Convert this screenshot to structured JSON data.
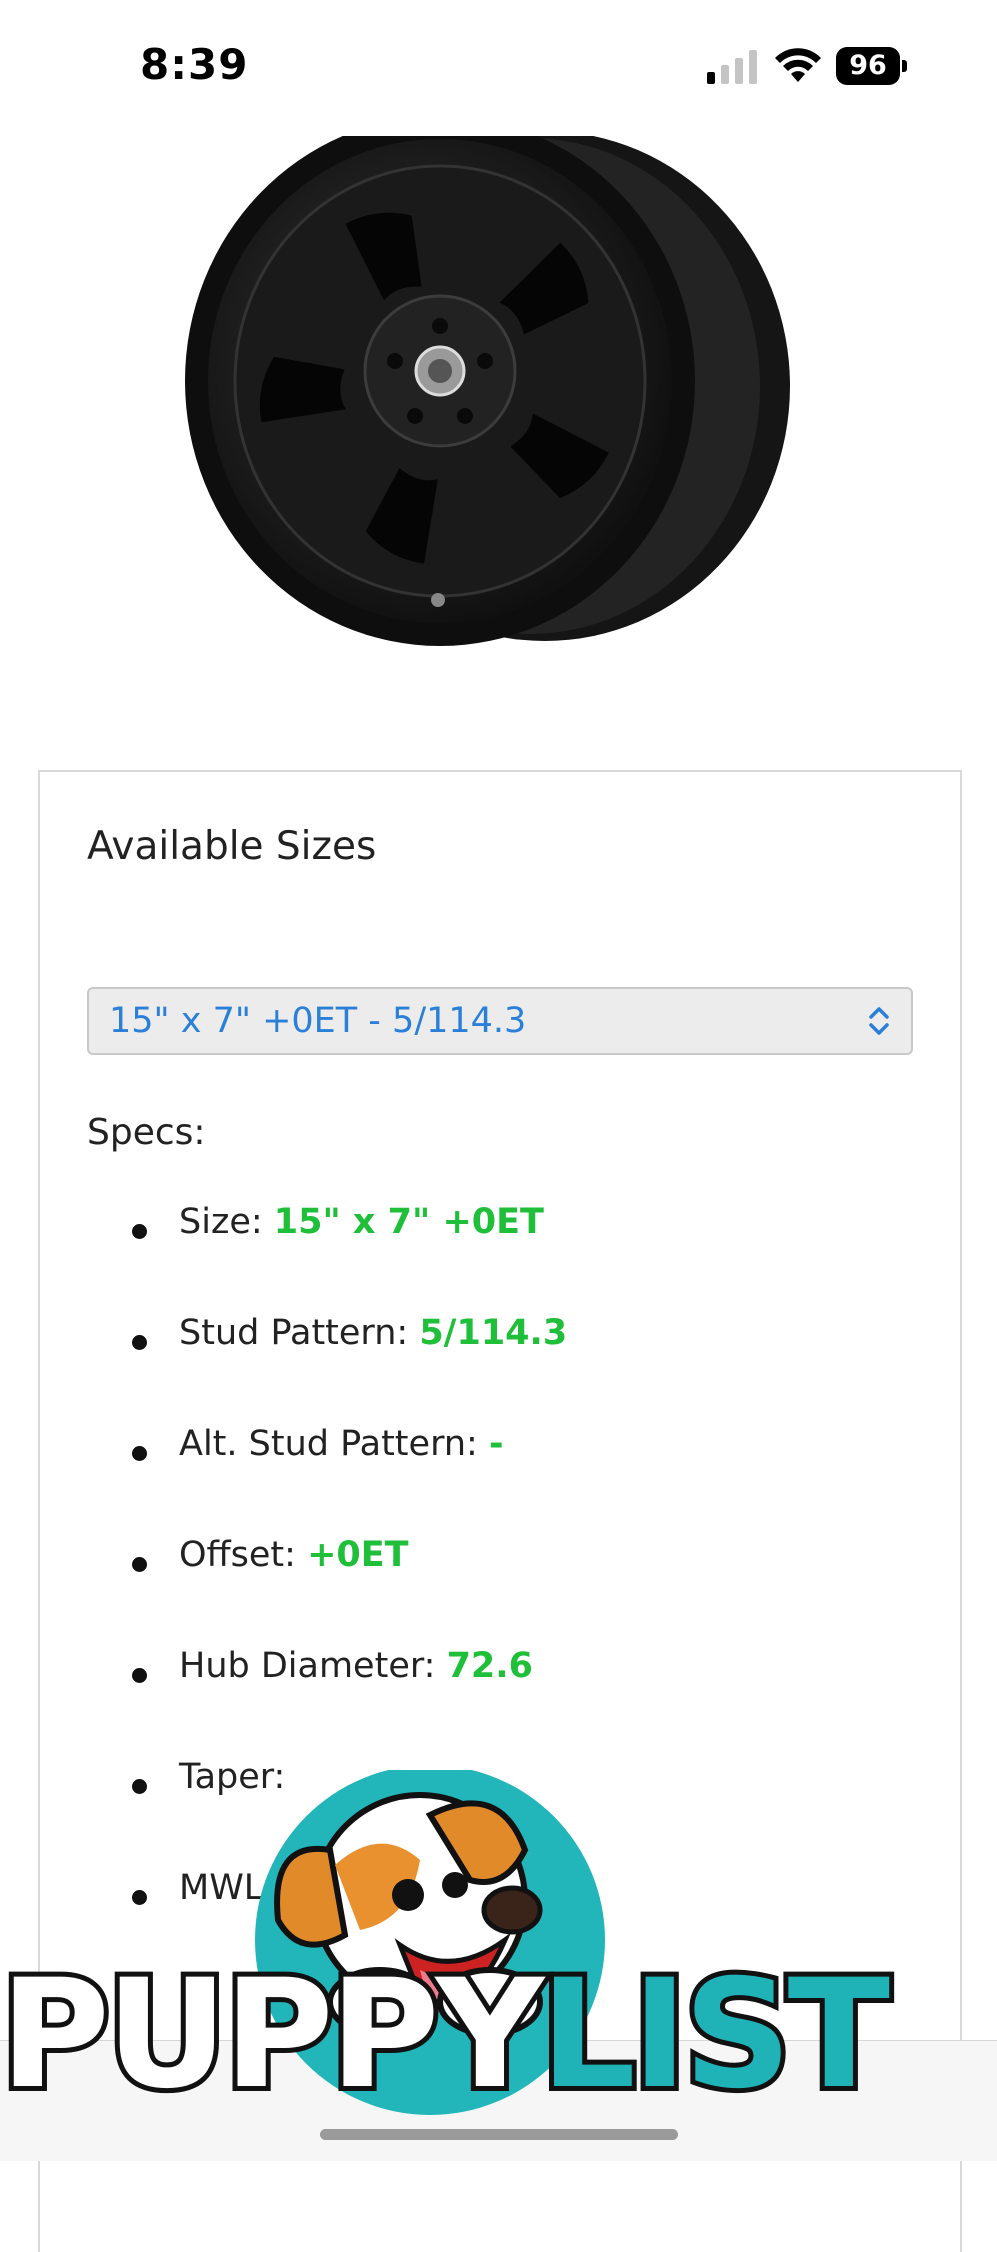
{
  "status_bar": {
    "time": "8:39",
    "battery": "96",
    "icons": [
      "cellular-signal-icon",
      "wifi-icon",
      "battery-icon"
    ]
  },
  "product": {
    "image": "wheel-image"
  },
  "sizes_card": {
    "title": "Available Sizes",
    "selected_size": "15\" x 7\" +0ET - 5/114.3",
    "specs_label": "Specs:",
    "specs": [
      {
        "label": "Size:",
        "value": "15\" x 7\" +0ET"
      },
      {
        "label": "Stud Pattern:",
        "value": "5/114.3"
      },
      {
        "label": "Alt. Stud Pattern:",
        "value": "-"
      },
      {
        "label": "Offset:",
        "value": "+0ET"
      },
      {
        "label": "Hub Diameter:",
        "value": "72.6"
      },
      {
        "label": "Taper:",
        "value": ""
      },
      {
        "label": "MWL",
        "value": ""
      }
    ]
  },
  "watermark": {
    "brand_part1": "PUPPY",
    "brand_part2": "LIST"
  },
  "colors": {
    "accent_blue": "#2a7fd8",
    "spec_value_green": "#1fbf3a",
    "watermark_teal": "#1fb3b8"
  }
}
